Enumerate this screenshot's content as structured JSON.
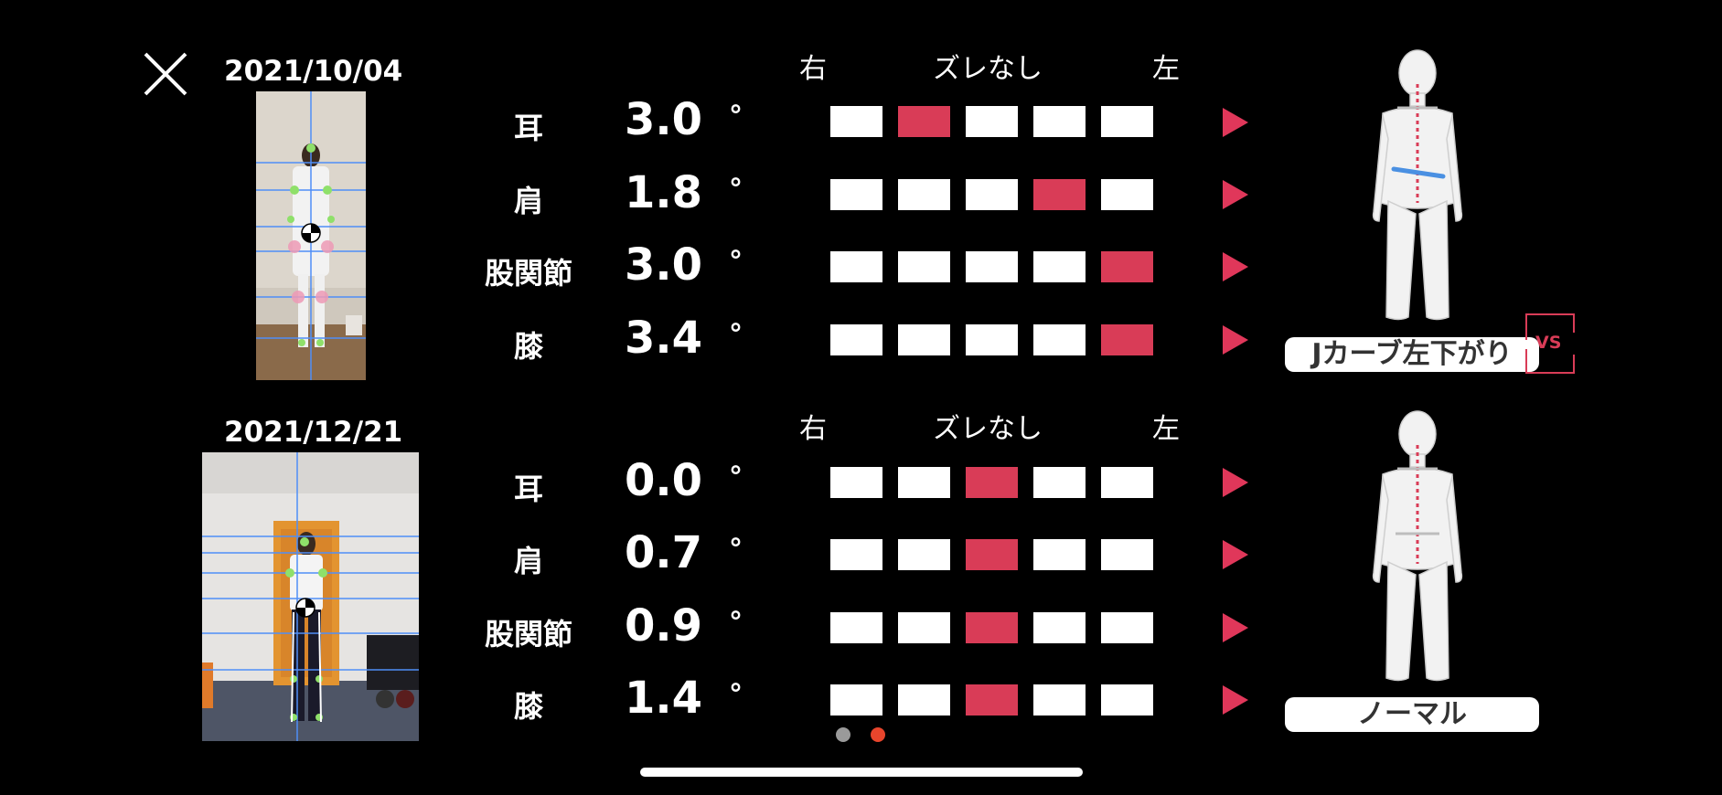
{
  "screen": {
    "close_icon": "close-icon",
    "accent_color": "#d93c57",
    "comparisons": [
      {
        "date": "2021/10/04",
        "header": {
          "right": "右",
          "center": "ズレなし",
          "left": "左"
        },
        "rows": [
          {
            "label": "耳",
            "value": "3.0",
            "unit": "°",
            "selected_box": 2
          },
          {
            "label": "肩",
            "value": "1.8",
            "unit": "°",
            "selected_box": 4
          },
          {
            "label": "股関節",
            "value": "3.0",
            "unit": "°",
            "selected_box": 5
          },
          {
            "label": "膝",
            "value": "3.4",
            "unit": "°",
            "selected_box": 5
          }
        ],
        "posture_result": "Jカーブ左下がり"
      },
      {
        "date": "2021/12/21",
        "header": {
          "right": "右",
          "center": "ズレなし",
          "left": "左"
        },
        "rows": [
          {
            "label": "耳",
            "value": "0.0",
            "unit": "°",
            "selected_box": 3
          },
          {
            "label": "肩",
            "value": "0.7",
            "unit": "°",
            "selected_box": 3
          },
          {
            "label": "股関節",
            "value": "0.9",
            "unit": "°",
            "selected_box": 3
          },
          {
            "label": "膝",
            "value": "1.4",
            "unit": "°",
            "selected_box": 3
          }
        ],
        "posture_result": "ノーマル"
      }
    ],
    "vs_label": "VS",
    "pager": {
      "count": 2,
      "active": 2
    }
  }
}
